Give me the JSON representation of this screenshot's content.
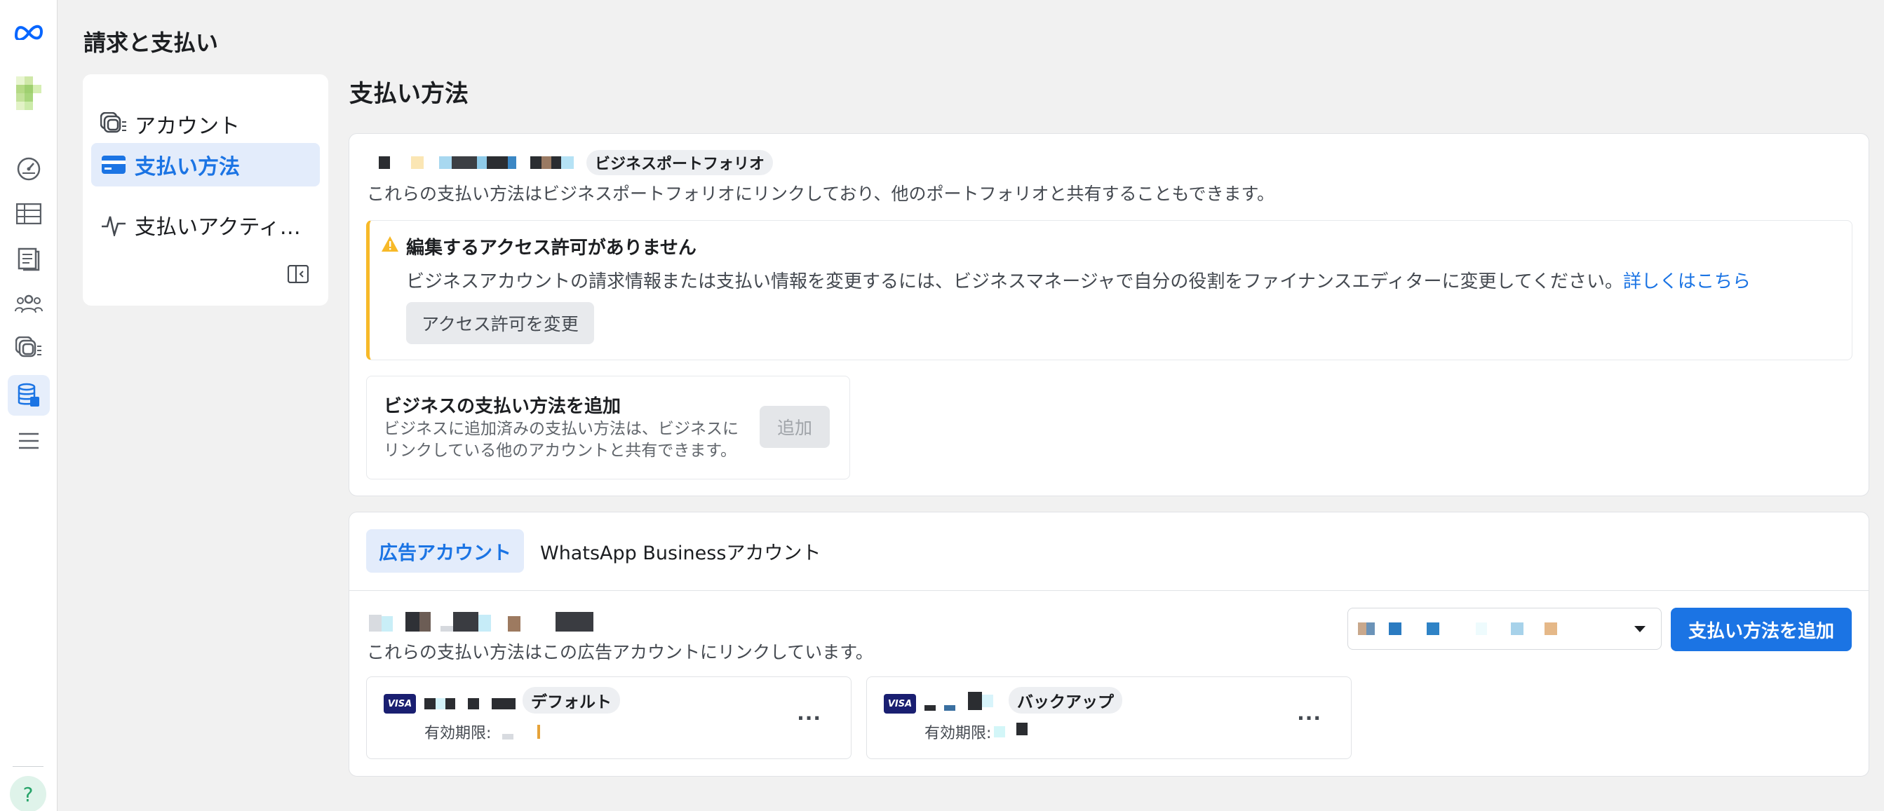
{
  "app": {
    "brand_icon": "meta-logo-icon",
    "title": "請求と支払い"
  },
  "rail": {
    "icons": [
      "meta-logo-icon",
      "business-avatar-icon",
      "dashboard-gauge-icon",
      "table-icon",
      "pages-icon",
      "people-icon",
      "accounts-icon",
      "billing-icon",
      "menu-icon"
    ],
    "help_label": "?"
  },
  "subnav": {
    "items": [
      {
        "label": "アカウント",
        "icon": "accounts-icon"
      },
      {
        "label": "支払い方法",
        "icon": "credit-card-icon"
      },
      {
        "label": "支払いアクティ…",
        "icon": "activity-icon"
      }
    ]
  },
  "main": {
    "title": "支払い方法",
    "portfolio": {
      "badge": "ビジネスポートフォリオ",
      "description": "これらの支払い方法はビジネスポートフォリオにリンクしており、他のポートフォリオと共有することもできます。"
    },
    "warning": {
      "title": "編集するアクセス許可がありません",
      "body": "ビジネスアカウントの請求情報または支払い情報を変更するには、ビジネスマネージャで自分の役割をファイナンスエディターに変更してください。",
      "link": "詳しくはこちら",
      "button": "アクセス許可を変更"
    },
    "add_business": {
      "title": "ビジネスの支払い方法を追加",
      "description": "ビジネスに追加済みの支払い方法は、ビジネスにリンクしている他のアカウントと共有できます。",
      "button": "追加"
    },
    "tabs": [
      "広告アカウント",
      "WhatsApp Businessアカウント"
    ],
    "ad_account": {
      "description": "これらの支払い方法はこの広告アカウントにリンクしています。",
      "add_button": "支払い方法を追加"
    },
    "payment_methods": [
      {
        "brand": "VISA",
        "tag": "デフォルト",
        "expiry_label": "有効期限:",
        "more": "···"
      },
      {
        "brand": "VISA",
        "tag": "バックアップ",
        "expiry_label": "有効期限:",
        "more": "···"
      }
    ]
  },
  "colors": {
    "accent": "#1b74e4",
    "warning": "#f7b928",
    "visa": "#1a1f71"
  }
}
